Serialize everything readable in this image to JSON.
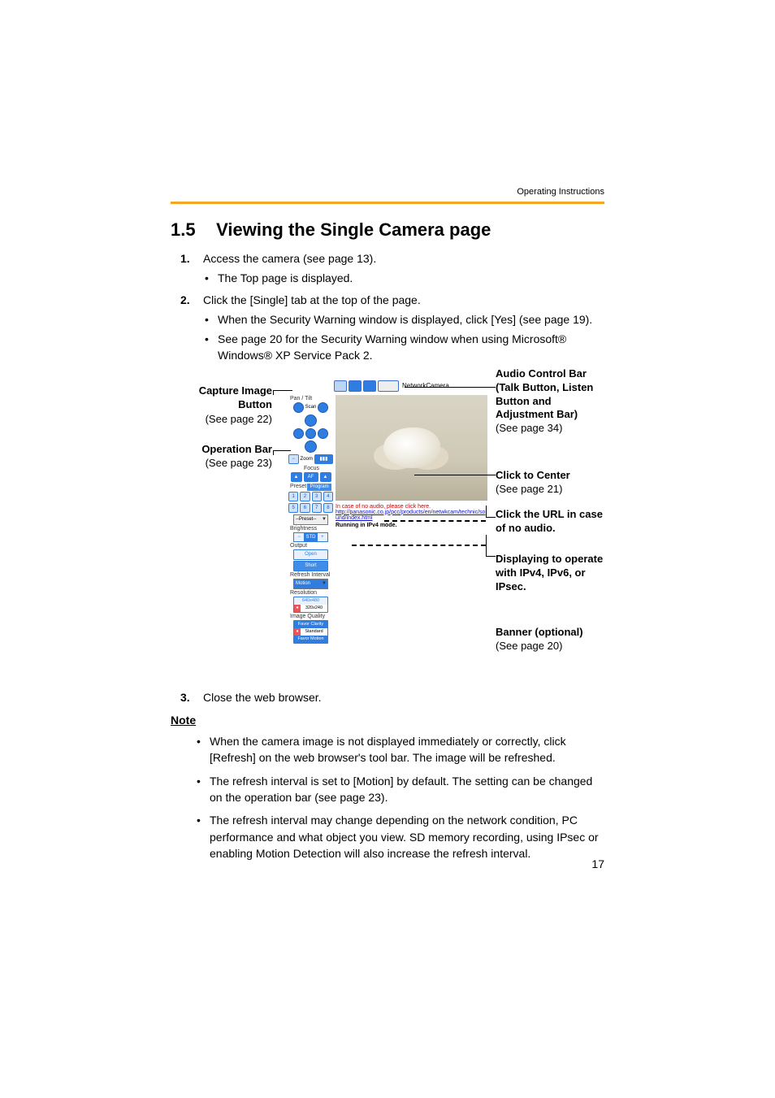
{
  "header": {
    "running": "Operating Instructions"
  },
  "section": {
    "number": "1.5",
    "title": "Viewing the Single Camera page"
  },
  "steps": [
    {
      "num": "1.",
      "text": "Access the camera (see page 13).",
      "sub": [
        "The Top page is displayed."
      ]
    },
    {
      "num": "2.",
      "text": "Click the [Single] tab at the top of the page.",
      "sub": [
        "When the Security Warning window is displayed, click [Yes] (see page 19).",
        "See page 20 for the Security Warning window when using Microsoft® Windows® XP Service Pack 2."
      ]
    },
    {
      "num": "3.",
      "text": "Close the web browser.",
      "sub": []
    }
  ],
  "callouts_left": [
    {
      "title": "Capture Image Button",
      "ref": "(See page 22)"
    },
    {
      "title": "Operation Bar",
      "ref": "(See page 23)"
    }
  ],
  "callouts_right": [
    {
      "title": "Audio Control Bar (Talk Button, Listen Button and Adjustment Bar)",
      "ref": "(See page 34)"
    },
    {
      "title": "Click to Center",
      "ref": "(See page 21)"
    },
    {
      "title": "Click the URL in case of no audio.",
      "ref": ""
    },
    {
      "title": "Displaying to operate with IPv4, IPv6, or IPsec.",
      "ref": ""
    },
    {
      "title": "Banner (optional)",
      "ref": "(See page 20)"
    }
  ],
  "shot": {
    "title": "NetworkCamera",
    "panels": {
      "pantilt": "Pan / Tilt",
      "scan": "Scan",
      "zoom": "Zoom",
      "focus": "Focus",
      "af": "AF",
      "preset": "Preset",
      "program": "Program",
      "preset_dd": "--Preset--",
      "brightness": "Brightness",
      "std": "STD",
      "output": "Output",
      "open": "Open",
      "short": "Short",
      "refresh": "Refresh Interval",
      "motion": "Motion",
      "resolution": "Resolution",
      "res1": "640x480",
      "res2": "320x240",
      "iq": "Image Quality",
      "iq1": "Favor Clarity",
      "iq2": "Standard",
      "iq3": "Favor Motion"
    },
    "below": {
      "red": "In case of no audio, please click here.",
      "link": "http://panasonic.co.jp/pcc/products/en/netwkcam/technic/sound/index.html",
      "mode": "Running in IPv4 mode."
    }
  },
  "note_heading": "Note",
  "notes": [
    "When the camera image is not displayed immediately or correctly, click [Refresh] on the web browser's tool bar. The image will be refreshed.",
    "The refresh interval is set to [Motion] by default. The setting can be changed on the operation bar (see page 23).",
    "The refresh interval may change depending on the network condition, PC performance and what object you view. SD memory recording, using IPsec or enabling Motion Detection will also increase the refresh interval."
  ],
  "page_number": "17"
}
